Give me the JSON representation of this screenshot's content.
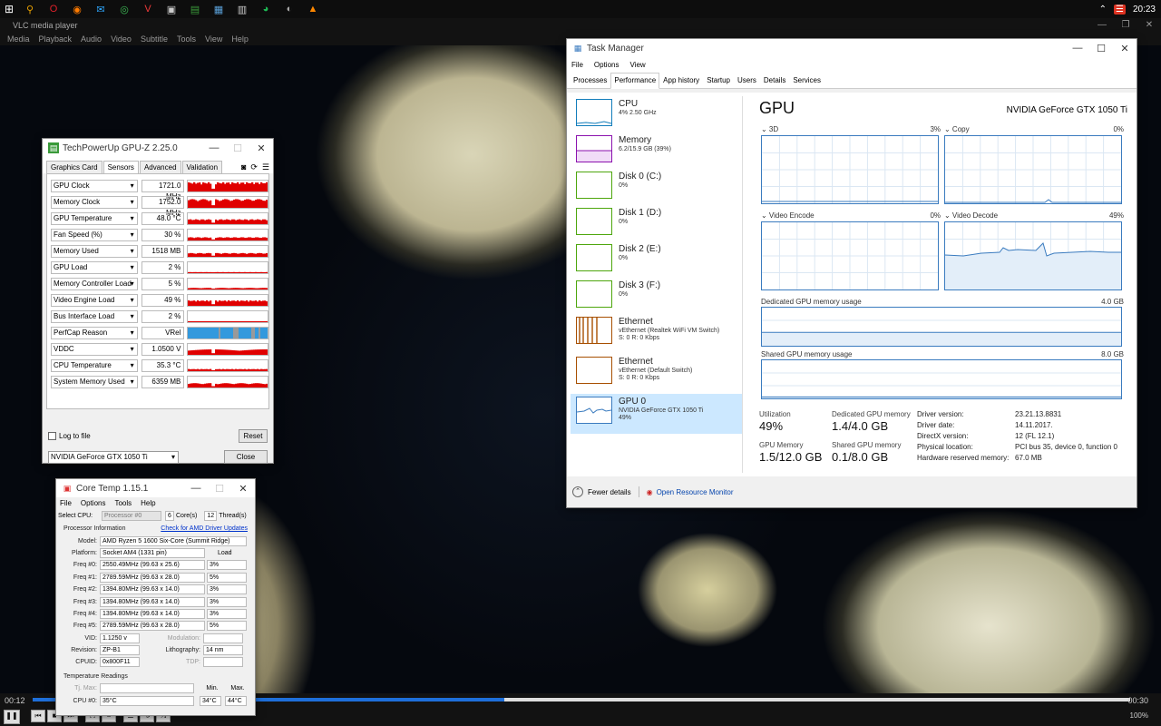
{
  "taskbar": {
    "time": "20:23",
    "icons": [
      {
        "name": "search-icon",
        "glyph": "⚲",
        "color": "#e8a000"
      },
      {
        "name": "opera-icon",
        "glyph": "O",
        "color": "#e0202a"
      },
      {
        "name": "firefox-icon",
        "glyph": "◉",
        "color": "#ff7b00"
      },
      {
        "name": "mail-icon",
        "glyph": "✉",
        "color": "#2ea8ff"
      },
      {
        "name": "chrome-icon",
        "glyph": "◎",
        "color": "#3cba54"
      },
      {
        "name": "vivaldi-icon",
        "glyph": "V",
        "color": "#ef3939"
      },
      {
        "name": "sandbox-icon",
        "glyph": "▣",
        "color": "#cccccc"
      },
      {
        "name": "gpuz-icon",
        "glyph": "▤",
        "color": "#3a9a3a"
      },
      {
        "name": "taskmanager-icon",
        "glyph": "▦",
        "color": "#5aa0d8"
      },
      {
        "name": "notepad-icon",
        "glyph": "▥",
        "color": "#cccccc"
      },
      {
        "name": "spotify-icon",
        "glyph": "◕",
        "color": "#1db954"
      },
      {
        "name": "media-icon",
        "glyph": "◐",
        "color": "#aaaaaa"
      },
      {
        "name": "vlc-icon",
        "glyph": "▲",
        "color": "#ff8800"
      }
    ]
  },
  "vlc": {
    "title": "VLC media player",
    "menu": [
      "Media",
      "Playback",
      "Audio",
      "Video",
      "Subtitle",
      "Tools",
      "View",
      "Help"
    ],
    "time_elapsed": "00:12",
    "time_total": "00:30",
    "progress": 0.43,
    "volume": "100%"
  },
  "gpuz": {
    "title": "TechPowerUp GPU-Z 2.25.0",
    "tabs": [
      "Graphics Card",
      "Sensors",
      "Advanced",
      "Validation"
    ],
    "selected_tab": "Sensors",
    "sensors": [
      {
        "label": "GPU Clock",
        "value": "1721.0 MHz",
        "level": 0.85
      },
      {
        "label": "Memory Clock",
        "value": "1752.0 MHz",
        "level": 0.8
      },
      {
        "label": "GPU Temperature",
        "value": "48.0 °C",
        "level": 0.45
      },
      {
        "label": "Fan Speed (%)",
        "value": "30 %",
        "level": 0.3
      },
      {
        "label": "Memory Used",
        "value": "1518 MB",
        "level": 0.35
      },
      {
        "label": "GPU Load",
        "value": "2 %",
        "level": 0.1
      },
      {
        "label": "Memory Controller Load",
        "value": "5 %",
        "level": 0.15
      },
      {
        "label": "Video Engine Load",
        "value": "49 %",
        "level": 0.5
      },
      {
        "label": "Bus Interface Load",
        "value": "2 %",
        "level": 0.08
      },
      {
        "label": "PerfCap Reason",
        "value": "VRel",
        "level": 1.0
      },
      {
        "label": "VDDC",
        "value": "1.0500 V",
        "level": 0.5
      },
      {
        "label": "CPU Temperature",
        "value": "35.3 °C",
        "level": 0.2
      },
      {
        "label": "System Memory Used",
        "value": "6359 MB",
        "level": 0.4
      }
    ],
    "log_to_file": "Log to file",
    "reset": "Reset",
    "device": "NVIDIA GeForce GTX 1050 Ti",
    "close": "Close"
  },
  "coretemp": {
    "title": "Core Temp 1.15.1",
    "menu": [
      "File",
      "Options",
      "Tools",
      "Help"
    ],
    "select_cpu": "Select CPU:",
    "processor": "Processor #0",
    "cores": "6",
    "cores_label": "Core(s)",
    "threads": "12",
    "threads_label": "Thread(s)",
    "proc_info": "Processor Information",
    "driver_link": "Check for AMD Driver Updates",
    "model_label": "Model:",
    "model": "AMD Ryzen 5 1600 Six-Core (Summit Ridge)",
    "platform_label": "Platform:",
    "platform": "Socket AM4 (1331 pin)",
    "load_label": "Load",
    "freqs": [
      {
        "label": "Freq #0:",
        "value": "2550.49MHz (99.63 x 25.6)",
        "load": "3%"
      },
      {
        "label": "Freq #1:",
        "value": "2789.59MHz (99.63 x 28.0)",
        "load": "5%"
      },
      {
        "label": "Freq #2:",
        "value": "1394.80MHz (99.63 x 14.0)",
        "load": "3%"
      },
      {
        "label": "Freq #3:",
        "value": "1394.80MHz (99.63 x 14.0)",
        "load": "3%"
      },
      {
        "label": "Freq #4:",
        "value": "1394.80MHz (99.63 x 14.0)",
        "load": "3%"
      },
      {
        "label": "Freq #5:",
        "value": "2789.59MHz (99.63 x 28.0)",
        "load": "5%"
      }
    ],
    "vid_label": "VID:",
    "vid": "1.1250 v",
    "modulation_label": "Modulation:",
    "revision_label": "Revision:",
    "revision": "ZP-B1",
    "litho_label": "Lithography:",
    "litho": "14 nm",
    "cpuid_label": "CPUID:",
    "cpuid": "0x800F11",
    "tdp_label": "TDP:",
    "temps": "Temperature Readings",
    "tjmax_label": "Tj. Max:",
    "min_label": "Min.",
    "max_label": "Max.",
    "cpu0_label": "CPU #0:",
    "cpu0": "35°C",
    "cpu0_min": "34°C",
    "cpu0_max": "44°C"
  },
  "taskmgr": {
    "title": "Task Manager",
    "menu": [
      "File",
      "Options",
      "View"
    ],
    "tabs": [
      "Processes",
      "Performance",
      "App history",
      "Startup",
      "Users",
      "Details",
      "Services"
    ],
    "selected_tab": "Performance",
    "items": [
      {
        "name": "CPU",
        "sub1": "4%  2.50 GHz",
        "sub2": "",
        "color": "#117dbb"
      },
      {
        "name": "Memory",
        "sub1": "6.2/15.9 GB (39%)",
        "sub2": "",
        "color": "#8b12ae"
      },
      {
        "name": "Disk 0 (C:)",
        "sub1": "0%",
        "sub2": "",
        "color": "#4da60c"
      },
      {
        "name": "Disk 1 (D:)",
        "sub1": "0%",
        "sub2": "",
        "color": "#4da60c"
      },
      {
        "name": "Disk 2 (E:)",
        "sub1": "0%",
        "sub2": "",
        "color": "#4da60c"
      },
      {
        "name": "Disk 3 (F:)",
        "sub1": "0%",
        "sub2": "",
        "color": "#4da60c"
      },
      {
        "name": "Ethernet",
        "sub1": "vEthernet (Realtek WiFi VM Switch)",
        "sub2": "S: 0  R: 0 Kbps",
        "color": "#a74f01"
      },
      {
        "name": "Ethernet",
        "sub1": "vEthernet (Default Switch)",
        "sub2": "S: 0  R: 0 Kbps",
        "color": "#a74f01"
      },
      {
        "name": "GPU 0",
        "sub1": "NVIDIA GeForce GTX 1050 Ti",
        "sub2": "49%",
        "color": "#3a7bbf"
      }
    ],
    "selected_index": 8,
    "heading": "GPU",
    "gpu_name": "NVIDIA GeForce GTX 1050 Ti",
    "engines": [
      {
        "name": "3D",
        "pct": "3%"
      },
      {
        "name": "Copy",
        "pct": "0%"
      },
      {
        "name": "Video Encode",
        "pct": "0%"
      },
      {
        "name": "Video Decode",
        "pct": "49%"
      }
    ],
    "dedicated_label": "Dedicated GPU memory usage",
    "dedicated_max": "4.0 GB",
    "shared_label": "Shared GPU memory usage",
    "shared_max": "8.0 GB",
    "stats": {
      "utilization_label": "Utilization",
      "utilization": "49%",
      "dedicated_label": "Dedicated GPU memory",
      "dedicated": "1.4/4.0 GB",
      "gpumem_label": "GPU Memory",
      "gpumem": "1.5/12.0 GB",
      "shared_label": "Shared GPU memory",
      "shared": "0.1/8.0 GB"
    },
    "info": [
      {
        "k": "Driver version:",
        "v": "23.21.13.8831"
      },
      {
        "k": "Driver date:",
        "v": "14.11.2017."
      },
      {
        "k": "DirectX version:",
        "v": "12 (FL 12.1)"
      },
      {
        "k": "Physical location:",
        "v": "PCI bus 35, device 0, function 0"
      },
      {
        "k": "Hardware reserved memory:",
        "v": "67.0 MB"
      }
    ],
    "fewer_details": "Fewer details",
    "resource_monitor": "Open Resource Monitor"
  }
}
